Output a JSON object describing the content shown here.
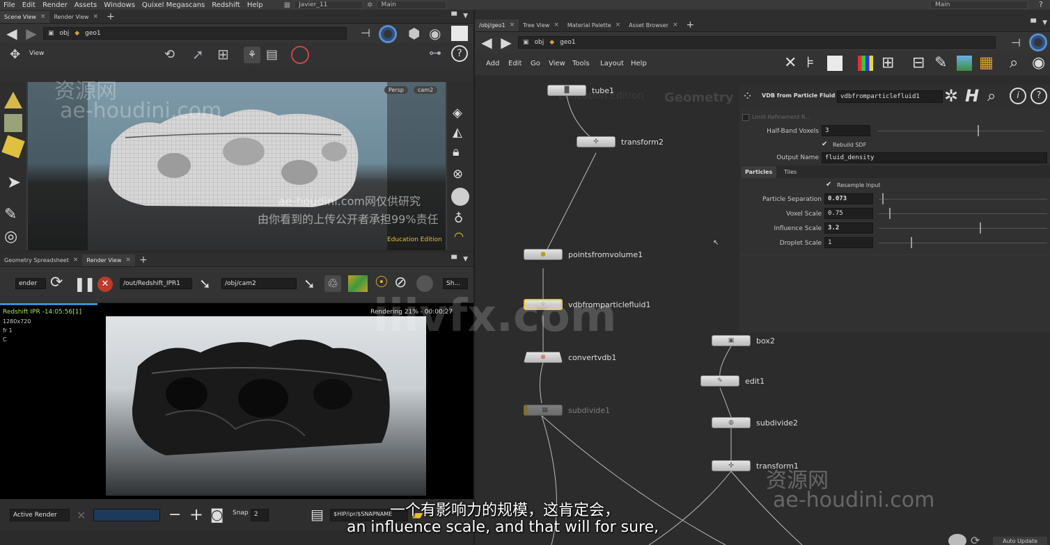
{
  "menubar": {
    "items": [
      "File",
      "Edit",
      "Render",
      "Assets",
      "Windows",
      "Quixel Megascans",
      "Redshift",
      "Help"
    ],
    "desktop": "Javier_11",
    "context": "Main",
    "right_desktop": "Main"
  },
  "scene_view": {
    "tabs": [
      "Scene View",
      "Render View"
    ],
    "path_obj": "obj",
    "path_geo": "geo1",
    "view_label": "View",
    "persp": "Persp",
    "cam": "cam2",
    "education": "Education Edition"
  },
  "spreadsheet": {
    "tabs": [
      "Geometry Spreadsheet",
      "Render View"
    ],
    "render_field": "ender",
    "rop_path": "/out/Redshift_IPR1",
    "cam_path": "/obj/cam2",
    "shader_field": "Sh...",
    "ipr_title": "Redshift IPR -14:05:56[1]",
    "ipr_res": "1280x720",
    "ipr_frame": "fr 1",
    "ipr_c": "C",
    "rendering": "Rendering 21% - 00:00:27",
    "active_render": "Active Render",
    "snap": "Snap",
    "snap_num": "2",
    "snapname": "$HIP/ipr/$SNAPNAME"
  },
  "network": {
    "tabs": [
      "/obj/geo1",
      "Tree View",
      "Material Palette",
      "Asset Browser"
    ],
    "path_obj": "obj",
    "path_geo": "geo1",
    "menu": [
      "Add",
      "Edit",
      "Go",
      "View",
      "Tools",
      "Layout",
      "Help"
    ],
    "bg_edition": "Education Edition",
    "bg_context": "Geometry",
    "nodes": {
      "tube1": "tube1",
      "transform2": "transform2",
      "pointsfromvolume1": "pointsfromvolume1",
      "vdbfromparticlefluid1": "vdbfromparticlefluid1",
      "convertvdb1": "convertvdb1",
      "subdivide1": "subdivide1",
      "box2": "box2",
      "edit1": "edit1",
      "subdivide2": "subdivide2",
      "transform1": "transform1"
    }
  },
  "params": {
    "node_type": "VDB from Particle Fluid",
    "node_name": "vdbfromparticlefluid1",
    "limit_refinement": "Limit Refinement R...",
    "half_band_label": "Half-Band Voxels",
    "half_band_value": "3",
    "half_band_level": 0.6,
    "rebuild_sdf": "Rebuild SDF",
    "output_name_label": "Output Name",
    "output_name_value": "fluid_density",
    "tabs": [
      "Particles",
      "Tiles"
    ],
    "resample_input": "Resample Input",
    "particle_sep_label": "Particle Separation",
    "particle_sep_value": "0.073",
    "particle_sep_level": 0.02,
    "voxel_scale_label": "Voxel Scale",
    "voxel_scale_value": "0.75",
    "voxel_scale_level": 0.06,
    "influence_label": "Influence Scale",
    "influence_value": "3.2",
    "influence_level": 0.6,
    "droplet_label": "Droplet Scale",
    "droplet_value": "1",
    "droplet_level": 0.19
  },
  "watermarks": {
    "cn_site": "资源网",
    "site": "ae-houdini.com",
    "notice1": "ae-houdini.com网仅供研究",
    "notice2": "由你看到的上传公开者承担99%责任",
    "center": "iiivfx.com"
  },
  "subtitles": {
    "cn": "一个有影响力的规模，这肯定会，",
    "en": "an influence scale, and that will for sure,"
  },
  "statusbar": {
    "auto_update": "Auto Update"
  }
}
